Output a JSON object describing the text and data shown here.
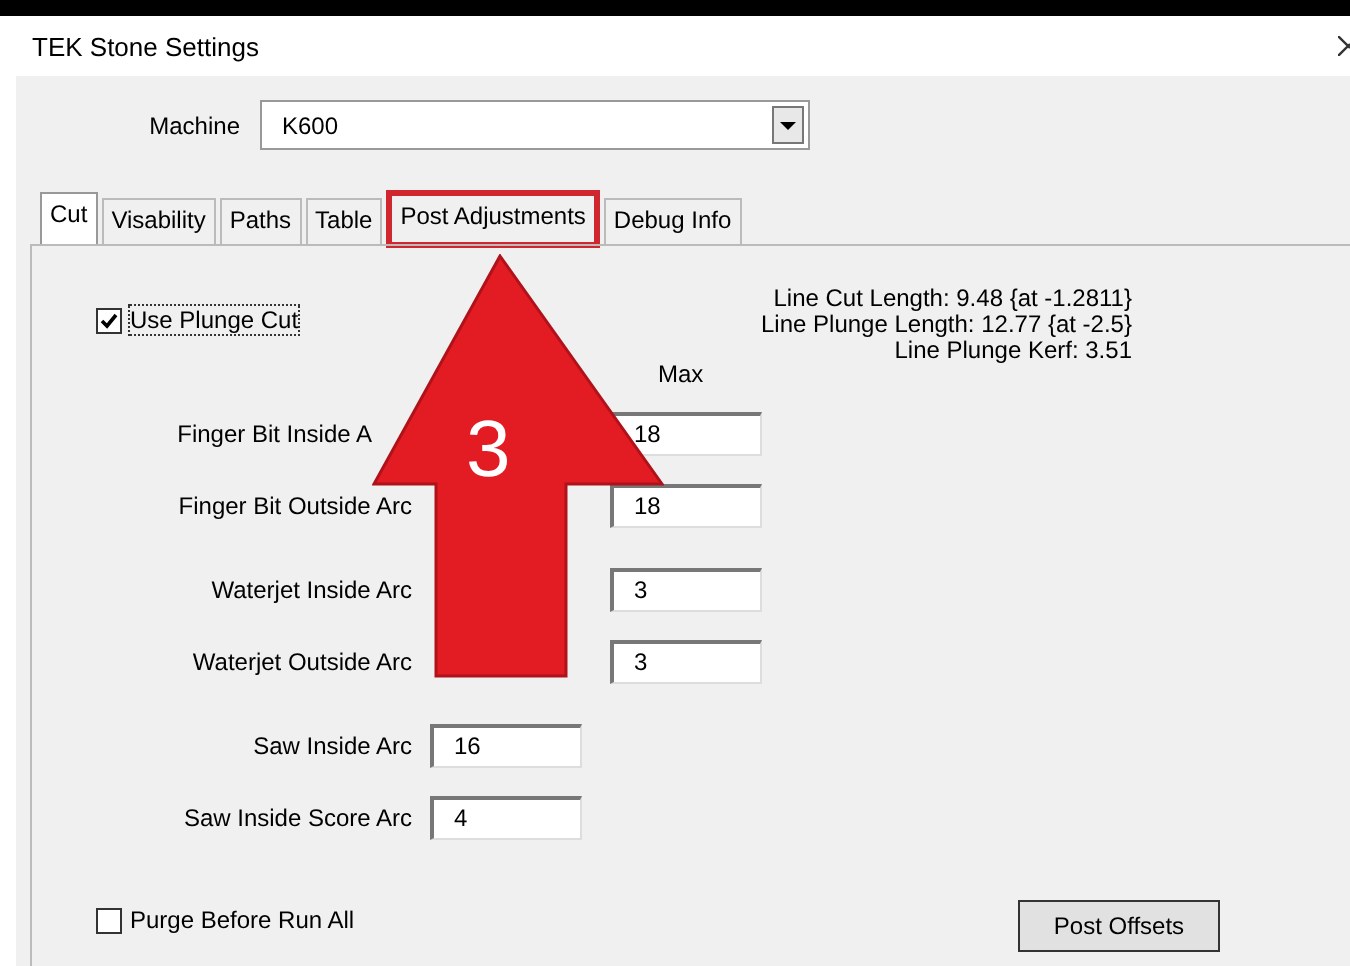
{
  "window": {
    "title": "TEK Stone Settings"
  },
  "machine": {
    "label": "Machine",
    "value": "K600"
  },
  "tabs": [
    {
      "label": "Cut",
      "selected": true,
      "highlighted": false
    },
    {
      "label": "Visability",
      "selected": false,
      "highlighted": false
    },
    {
      "label": "Paths",
      "selected": false,
      "highlighted": false
    },
    {
      "label": "Table",
      "selected": false,
      "highlighted": false
    },
    {
      "label": "Post Adjustments",
      "selected": false,
      "highlighted": true
    },
    {
      "label": "Debug Info",
      "selected": false,
      "highlighted": false
    }
  ],
  "plunge": {
    "label": "Use Plunge Cut",
    "checked": true
  },
  "info": [
    "Line Cut Length: 9.48 {at -1.2811}",
    "Line Plunge Length: 12.77 {at -2.5}",
    "Line Plunge Kerf: 3.51"
  ],
  "max_header": "Max",
  "arc_groups": [
    [
      {
        "kind": "range",
        "label": "Finger Bit Inside A",
        "max": "18",
        "obscured": true
      },
      {
        "kind": "range",
        "label": "Finger Bit Outside Arc",
        "max": "18",
        "obscured": false
      }
    ],
    [
      {
        "kind": "range",
        "label": "Waterjet Inside Arc",
        "max": "3",
        "obscured": false
      },
      {
        "kind": "range",
        "label": "Waterjet Outside Arc",
        "max": "3",
        "obscured": false
      }
    ],
    [
      {
        "kind": "single",
        "label": "Saw Inside Arc",
        "value": "16",
        "obscured": false
      },
      {
        "kind": "single",
        "label": "Saw Inside Score Arc",
        "value": "4",
        "obscured": false
      }
    ]
  ],
  "purge": {
    "label": "Purge Before Run All",
    "checked": false
  },
  "button": "Post Offsets",
  "annotation": {
    "number": "3"
  }
}
